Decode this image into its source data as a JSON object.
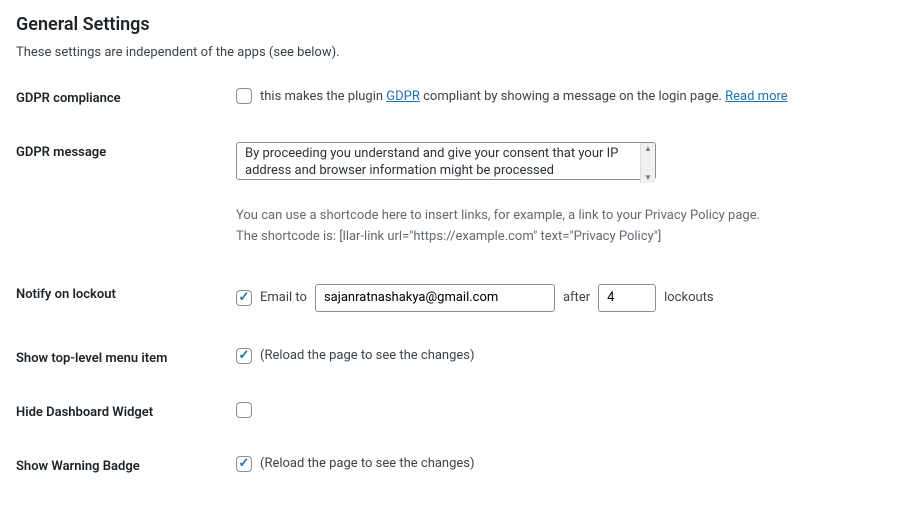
{
  "title": "General Settings",
  "description": "These settings are independent of the apps (see below).",
  "gdpr_compliance": {
    "label": "GDPR compliance",
    "text_before": "this makes the plugin ",
    "link_gdpr": "GDPR",
    "text_mid": " compliant by showing a message on the login page. ",
    "link_readmore": "Read more",
    "checked": false
  },
  "gdpr_message": {
    "label": "GDPR message",
    "value": "By proceeding you understand and give your consent that your IP address and browser information might be processed",
    "hint1": "You can use a shortcode here to insert links, for example, a link to your Privacy Policy page.",
    "hint2": "The shortcode is: [llar-link url=\"https://example.com\" text=\"Privacy Policy\"]"
  },
  "notify": {
    "label": "Notify on lockout",
    "checked": true,
    "email_to_label": "Email to",
    "email_value": "sajanratnashakya@gmail.com",
    "after_label": "after",
    "count_value": "4",
    "lockouts_label": "lockouts"
  },
  "show_toplevel": {
    "label": "Show top-level menu item",
    "checked": true,
    "note": "(Reload the page to see the changes)"
  },
  "hide_dashboard": {
    "label": "Hide Dashboard Widget",
    "checked": false
  },
  "show_badge": {
    "label": "Show Warning Badge",
    "checked": true,
    "note": "(Reload the page to see the changes)"
  }
}
